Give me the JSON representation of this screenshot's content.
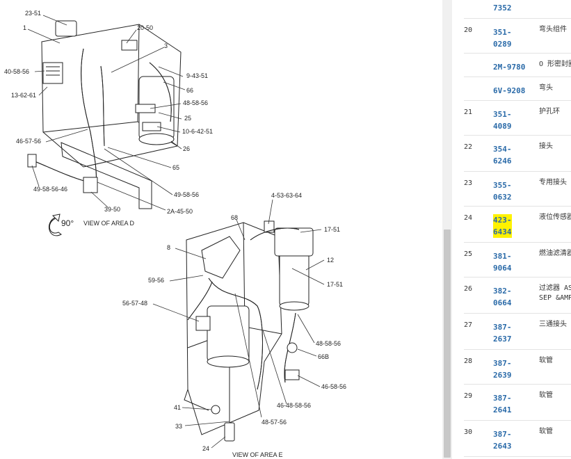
{
  "diagram": {
    "area_d": {
      "callouts": [
        "23-51",
        "1",
        "20-50",
        "40-58-56",
        "3",
        "9-43-51",
        "13-62-61",
        "66",
        "48-58-56",
        "25",
        "10-6-42-51",
        "46-57-56",
        "26",
        "65",
        "49-58-56-46",
        "49-58-56",
        "39-50",
        "2A-45-50"
      ],
      "rotation_label": "90°",
      "caption": "VIEW OF AREA  D"
    },
    "area_e": {
      "callouts": [
        "4-53-63-64",
        "68",
        "17-51",
        "8",
        "12",
        "59-56",
        "17-51",
        "56-57-48",
        "48-58-56",
        "66B",
        "46-58-56",
        "46-48-58-56",
        "41",
        "48-57-56",
        "33",
        "24"
      ],
      "caption": "VIEW OF AREA  E"
    }
  },
  "parts_list": {
    "rows": [
      {
        "num": "",
        "pn": [
          "7352"
        ],
        "desc": [
          ""
        ],
        "highlight": false
      },
      {
        "num": "20",
        "pn": [
          "351-",
          "0289"
        ],
        "desc": [
          "弯头组件"
        ],
        "highlight": false
      },
      {
        "num": "",
        "pn": [
          "2M-9780"
        ],
        "desc": [
          "O 形密封圈"
        ],
        "highlight": false
      },
      {
        "num": "",
        "pn": [
          "6V-9208"
        ],
        "desc": [
          "弯头"
        ],
        "highlight": false
      },
      {
        "num": "21",
        "pn": [
          "351-",
          "4089"
        ],
        "desc": [
          "护孔环"
        ],
        "highlight": false
      },
      {
        "num": "22",
        "pn": [
          "354-",
          "6246"
        ],
        "desc": [
          "接头"
        ],
        "highlight": false
      },
      {
        "num": "23",
        "pn": [
          "355-",
          "0632"
        ],
        "desc": [
          "专用接头"
        ],
        "highlight": false
      },
      {
        "num": "24",
        "pn": [
          "423-",
          "6434"
        ],
        "desc": [
          "液位传感器"
        ],
        "highlight": true
      },
      {
        "num": "25",
        "pn": [
          "381-",
          "9064"
        ],
        "desc": [
          "燃油滤清器"
        ],
        "highlight": false
      },
      {
        "num": "26",
        "pn": [
          "382-",
          "0664"
        ],
        "desc": [
          "过滤器 AS",
          "SEP &AMP;"
        ],
        "highlight": false
      },
      {
        "num": "27",
        "pn": [
          "387-",
          "2637"
        ],
        "desc": [
          "三通接头"
        ],
        "highlight": false
      },
      {
        "num": "28",
        "pn": [
          "387-",
          "2639"
        ],
        "desc": [
          "软管"
        ],
        "highlight": false
      },
      {
        "num": "29",
        "pn": [
          "387-",
          "2641"
        ],
        "desc": [
          "软管"
        ],
        "highlight": false
      },
      {
        "num": "30",
        "pn": [
          "387-",
          "2643"
        ],
        "desc": [
          "软管"
        ],
        "highlight": false
      }
    ]
  }
}
